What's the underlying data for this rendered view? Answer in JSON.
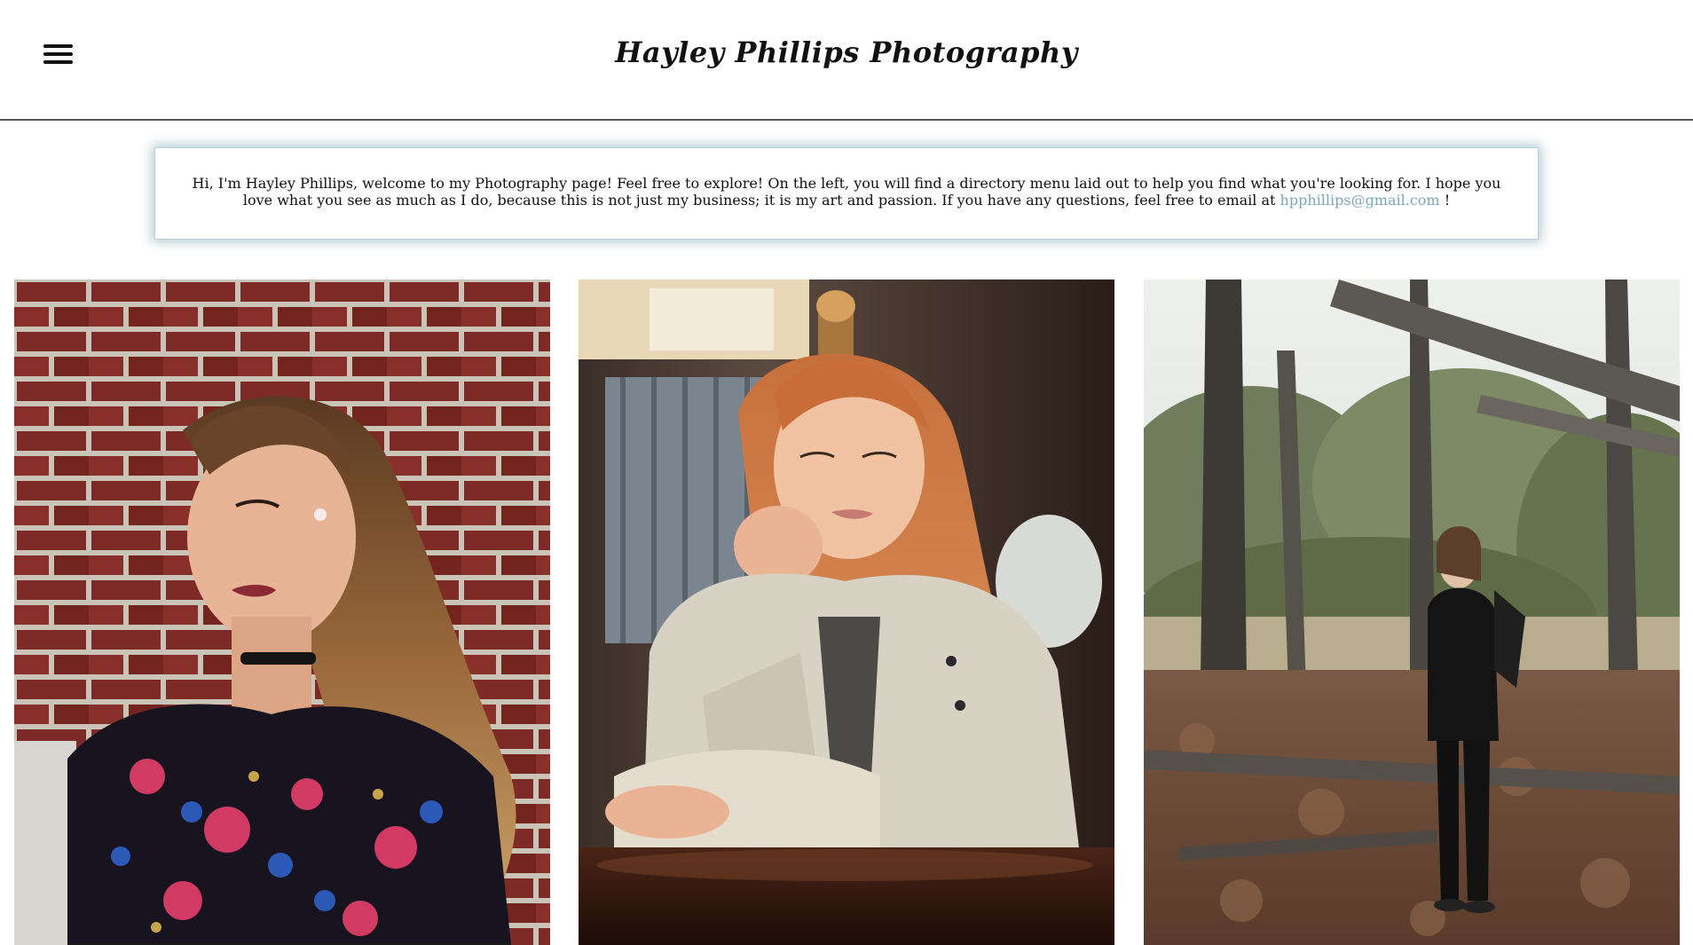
{
  "header": {
    "title": "Hayley Phillips Photography",
    "menu_icon": "hamburger-menu-icon"
  },
  "intro": {
    "text_before": "Hi, I'm Hayley Phillips, welcome to my Photography page! Feel free to explore! On the left, you will find a directory menu laid out to help you find what you're looking for. I hope you love what you see as much as I do, because this is not just my business; it is my art and passion. If you have any questions, feel free to email at ",
    "email": "hpphillips@gmail.com",
    "text_after": " !"
  },
  "colors": {
    "link": "#7aa6bf",
    "box_border": "#b9d3dc",
    "header_rule": "#555555"
  }
}
